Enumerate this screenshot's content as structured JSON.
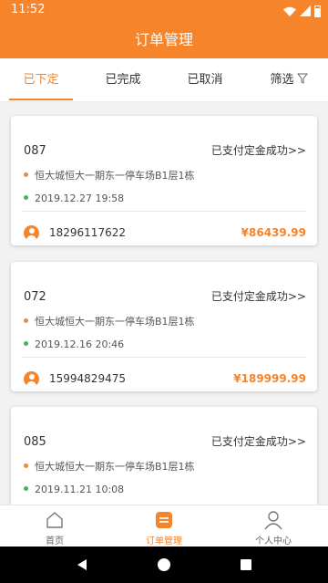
{
  "status_bar": {
    "time": "11:52"
  },
  "header": {
    "title": "订单管理"
  },
  "tabs": [
    {
      "label": "已下定",
      "active": true
    },
    {
      "label": "已完成",
      "active": false
    },
    {
      "label": "已取消",
      "active": false
    },
    {
      "label": "筛选",
      "active": false
    }
  ],
  "orders": [
    {
      "number": "087",
      "status": "已支付定金成功>>",
      "location": "恒大城恒大一期东一停车场B1层1栋",
      "date": "2019.12.27 19:58",
      "phone": "18296117622",
      "price": "¥86439.99"
    },
    {
      "number": "072",
      "status": "已支付定金成功>>",
      "location": "恒大城恒大一期东一停车场B1层1栋",
      "date": "2019.12.16 20:46",
      "phone": "15994829475",
      "price": "¥189999.99"
    },
    {
      "number": "085",
      "status": "已支付定金成功>>",
      "location": "恒大城恒大一期东一停车场B1层1栋",
      "date": "2019.11.21 10:08",
      "phone": "",
      "price": ""
    }
  ],
  "bottom_nav": [
    {
      "label": "首页",
      "icon": "home-icon",
      "active": false
    },
    {
      "label": "订单管理",
      "icon": "orders-icon",
      "active": true
    },
    {
      "label": "个人中心",
      "icon": "person-icon",
      "active": false
    }
  ],
  "colors": {
    "accent": "#f5842b",
    "location_dot": "#e88d3d",
    "date_dot": "#4caf50",
    "background": "#f2f2f2"
  },
  "icons": {
    "filter": "filter-icon",
    "avatar": "avatar-icon",
    "back": "back-icon",
    "home": "home-button-icon",
    "recents": "recents-icon"
  }
}
